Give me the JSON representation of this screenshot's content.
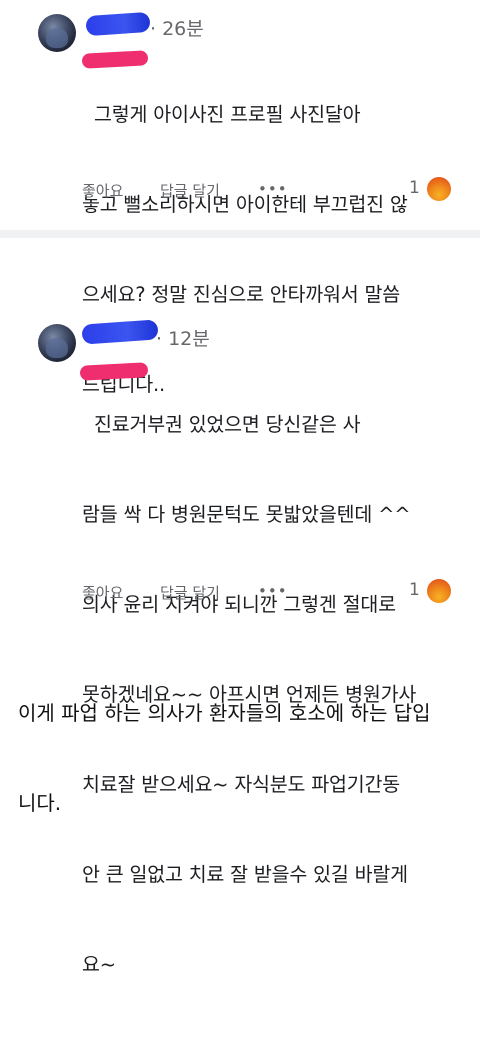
{
  "comments": [
    {
      "time": "· 26분",
      "text_lines": [
        "  그렇게 아이사진 프로필 사진달아",
        "놓고 뻘소리하시면 아이한테 부끄럽진 않",
        "으세요? 정말 진심으로 안타까워서 말씀",
        "드립니다.."
      ],
      "like_label": "좋아요",
      "reply_label": "답글 달기",
      "more_label": "•••",
      "reaction_count": "1"
    },
    {
      "time": "· 12분",
      "text_lines": [
        "  진료거부권 있었으면 당신같은 사",
        "람들 싹 다 병원문턱도 못밟았을텐데 ^^",
        "의사 윤리 지켜야 되니깐 그렇겐 절대로",
        "못하겠네요~~ 아프시면 언제든 병원가사",
        "치료잘 받으세요~ 자식분도 파업기간동",
        "안 큰 일없고 치료 잘 받을수 있길 바랄게",
        "요~"
      ],
      "like_label": "좋아요",
      "reply_label": "답글 달기",
      "more_label": "•••",
      "reaction_count": "1"
    }
  ],
  "caption_lines": [
    "이게 파업 하는 의사가 환자들의 호소에 하는 답입",
    "니다."
  ],
  "colors": {
    "scribble_blue": "#2c3eea",
    "scribble_pink": "#ee2e6e",
    "angry_reaction": "#f08a1c"
  },
  "icons": [
    "avatar",
    "angry-reaction-icon",
    "more-options-icon"
  ]
}
